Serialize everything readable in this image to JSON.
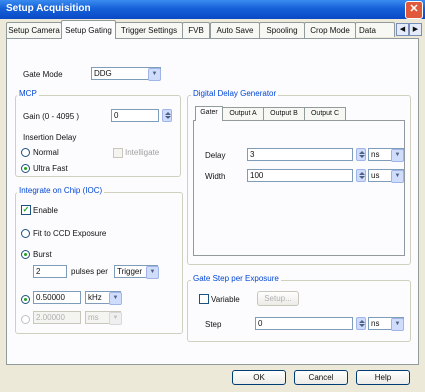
{
  "window": {
    "title": "Setup Acquisition",
    "close_glyph": "✕"
  },
  "tabs": [
    {
      "label": "Setup Camera"
    },
    {
      "label": "Setup Gating"
    },
    {
      "label": "Trigger Settings"
    },
    {
      "label": "FVB"
    },
    {
      "label": "Auto Save"
    },
    {
      "label": "Spooling"
    },
    {
      "label": "Crop Mode"
    },
    {
      "label": "Data"
    }
  ],
  "tab_scroll": {
    "left": "◀",
    "right": "▶"
  },
  "gate_mode": {
    "label": "Gate Mode",
    "value": "DDG"
  },
  "mcp": {
    "title": "MCP",
    "gain_label": "Gain (0 - 4095 )",
    "gain_value": "0",
    "insertion_delay_label": "Insertion Delay",
    "option_normal": "Normal",
    "option_ultrafast": "Ultra Fast",
    "intelligate_label": "Intelligate"
  },
  "ioc": {
    "title": "Integrate on Chip (IOC)",
    "enable_label": "Enable",
    "fit_label": "Fit to CCD Exposure",
    "burst_label": "Burst",
    "pulses_value": "2",
    "pulses_per_label": "pulses per",
    "trigger_value": "Trigger",
    "freq_value": "0.50000",
    "freq_unit": "kHz",
    "period_value": "2.00000",
    "period_unit": "ms"
  },
  "ddg": {
    "title": "Digital Delay Generator",
    "subtabs": [
      {
        "label": "Gater"
      },
      {
        "label": "Output A"
      },
      {
        "label": "Output B"
      },
      {
        "label": "Output C"
      }
    ],
    "delay_label": "Delay",
    "delay_value": "3",
    "delay_unit": "ns",
    "width_label": "Width",
    "width_value": "100",
    "width_unit": "us"
  },
  "gate_step": {
    "title": "Gate Step per Exposure",
    "variable_label": "Variable",
    "setup_button": "Setup...",
    "step_label": "Step",
    "step_value": "0",
    "step_unit": "ns"
  },
  "buttons": {
    "ok": "OK",
    "cancel": "Cancel",
    "help": "Help"
  },
  "icons": {
    "dropdown": "▼",
    "check": "✓"
  }
}
